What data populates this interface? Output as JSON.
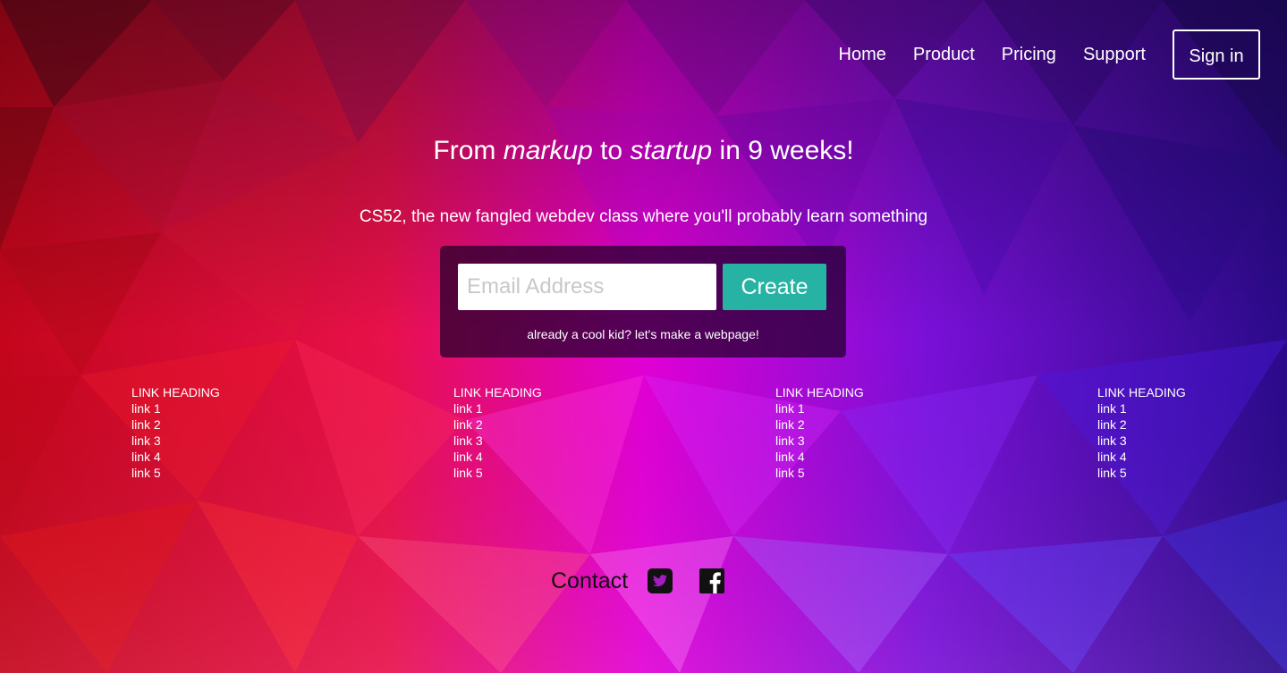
{
  "nav": {
    "items": [
      {
        "label": "Home"
      },
      {
        "label": "Product"
      },
      {
        "label": "Pricing"
      },
      {
        "label": "Support"
      }
    ],
    "sign_in": "Sign in"
  },
  "hero": {
    "title_prefix": "From ",
    "title_em1": "markup",
    "title_mid": " to ",
    "title_em2": "startup",
    "title_suffix": " in 9 weeks!",
    "subtitle": "CS52, the new fangled webdev class where you'll probably learn something"
  },
  "signup": {
    "email_placeholder": "Email Address",
    "create_label": "Create",
    "already_text": "already a cool kid? let's make a webpage!"
  },
  "link_columns": [
    {
      "heading": "LINK HEADING",
      "links": [
        "link 1",
        "link 2",
        "link 3",
        "link 4",
        "link 5"
      ]
    },
    {
      "heading": "LINK HEADING",
      "links": [
        "link 1",
        "link 2",
        "link 3",
        "link 4",
        "link 5"
      ]
    },
    {
      "heading": "LINK HEADING",
      "links": [
        "link 1",
        "link 2",
        "link 3",
        "link 4",
        "link 5"
      ]
    },
    {
      "heading": "LINK HEADING",
      "links": [
        "link 1",
        "link 2",
        "link 3",
        "link 4",
        "link 5"
      ]
    }
  ],
  "footer": {
    "contact_label": "Contact",
    "icons": [
      "twitter-icon",
      "facebook-icon"
    ]
  },
  "colors": {
    "accent_button": "#26b3a4",
    "form_panel": "#1e0028",
    "text": "#ffffff"
  }
}
